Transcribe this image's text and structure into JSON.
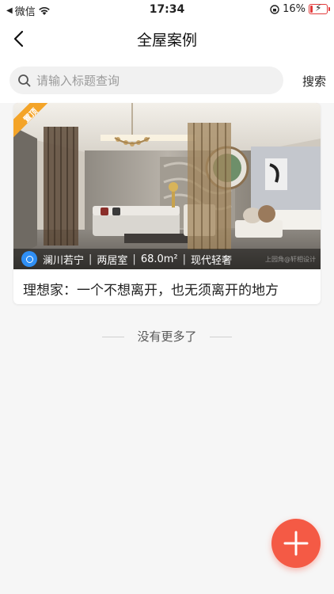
{
  "status_bar": {
    "carrier": "微信",
    "time": "17:34",
    "battery": "16%",
    "battery_level": 0.16
  },
  "nav": {
    "title": "全屋案例"
  },
  "search": {
    "placeholder": "请输入标题查询",
    "value": "",
    "button_label": "搜索"
  },
  "cases": [
    {
      "badge": "置顶",
      "designer": "澜川若宁",
      "layout": "两居室",
      "area": "68.0m²",
      "style": "现代轻奢",
      "watermark": "上园角@轩相设计",
      "title": "理想家：一个不想离开，也无须离开的地方"
    }
  ],
  "list_footer": {
    "text": "没有更多了"
  },
  "colors": {
    "accent": "#f45a45",
    "badge": "#f4a428",
    "avatar": "#2f8ff5",
    "battery_low": "#e23a3a"
  },
  "icons": {
    "back": "chevron-left-icon",
    "search": "search-icon",
    "add": "plus-icon",
    "wifi": "wifi-icon",
    "lock": "rotation-lock-icon"
  }
}
